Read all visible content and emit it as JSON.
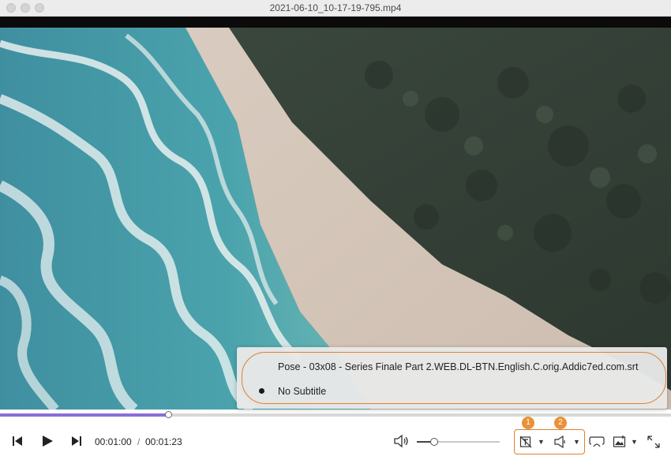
{
  "window": {
    "title": "2021-06-10_10-17-19-795.mp4"
  },
  "subtitle_menu": {
    "items": [
      {
        "label": "Pose - 03x08 - Series Finale Part 2.WEB.DL-BTN.English.C.orig.Addic7ed.com.srt",
        "selected": false
      },
      {
        "label": "No Subtitle",
        "selected": true
      }
    ]
  },
  "playback": {
    "current_time": "00:01:00",
    "separator": "/",
    "total_time": "00:01:23",
    "progress_fraction": 0.25,
    "volume_fraction": 0.21
  },
  "annotations": {
    "badge_1": "1",
    "badge_2": "2",
    "accent_color": "#e0812d"
  },
  "icons": {
    "prev": "skip-back-icon",
    "play": "play-icon",
    "next": "skip-forward-icon",
    "volume": "volume-icon",
    "subtitle": "subtitle-icon",
    "audio": "audio-track-icon",
    "airplay": "airplay-icon",
    "screenshot": "screenshot-icon",
    "fullscreen": "fullscreen-icon"
  }
}
